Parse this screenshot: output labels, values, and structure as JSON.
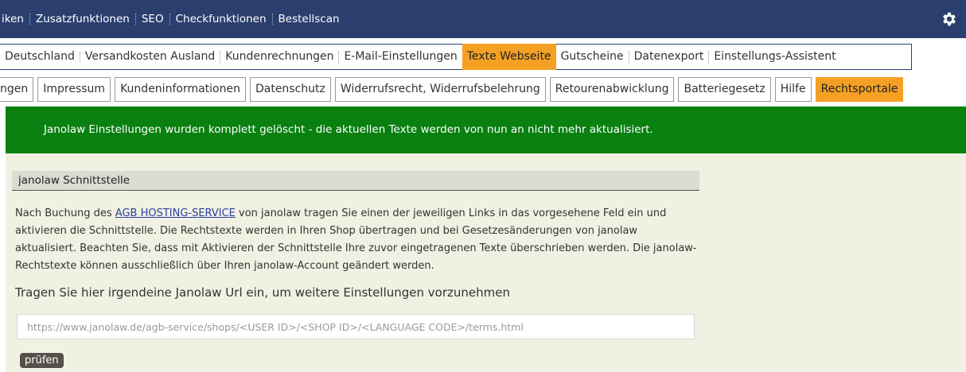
{
  "topnav": {
    "items": [
      "iken",
      "Zusatzfunktionen",
      "SEO",
      "Checkfunktionen",
      "Bestellscan"
    ],
    "settings_icon": "gear-icon",
    "background": "#2a3f6e"
  },
  "subnav": {
    "items": [
      "Deutschland",
      "Versandkosten Ausland",
      "Kundenrechnungen",
      "E-Mail-Einstellungen",
      "Texte Webseite",
      "Gutscheine",
      "Datenexport",
      "Einstellungs-Assistent"
    ],
    "active": "Texte Webseite"
  },
  "tabs": {
    "items": [
      "ngen",
      "Impressum",
      "Kundeninformationen",
      "Datenschutz",
      "Widerrufsrecht, Widerrufsbelehrung",
      "Retourenabwicklung",
      "Batteriegesetz",
      "Hilfe",
      "Rechtsportale"
    ],
    "active": "Rechtsportale",
    "accent": "#f5a025"
  },
  "banner": {
    "text": "Janolaw Einstellungen wurden komplett gelöscht - die aktuellen Texte werden von nun an nicht mehr aktualisiert.",
    "color": "#098010"
  },
  "panel": {
    "title": "janolaw Schnittstelle",
    "desc_before": "Nach Buchung des ",
    "desc_link": "AGB HOSTING-SERVICE",
    "desc_after": " von janolaw tragen Sie einen der jeweiligen Links in das vorgesehene Feld ein und aktivieren die Schnittstelle. Die Rechtstexte werden in Ihren Shop übertragen und bei Gesetzesänderungen von janolaw aktualisiert. Beachten Sie, dass mit Aktivieren der Schnittstelle Ihre zuvor eingetragenen Texte überschrieben werden. Die janolaw-Rechtstexte können ausschließlich über Ihren janolaw-Account geändert werden.",
    "prompt": "Tragen Sie hier irgendeine Janolaw Url ein, um weitere Einstellungen vorzunehmen",
    "url_placeholder": "https://www.janolaw.de/agb-service/shops/<USER ID>/<SHOP ID>/<LANGUAGE CODE>/terms.html",
    "url_value": "",
    "check_button": "prüfen"
  }
}
